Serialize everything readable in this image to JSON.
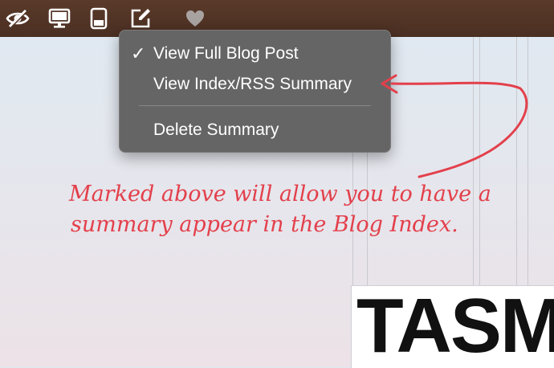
{
  "toolbar": {
    "icons": [
      "eye-slash-icon",
      "monitor-icon",
      "phone-icon",
      "edit-icon",
      "heart-icon"
    ]
  },
  "menu": {
    "items": [
      {
        "label": "View Full Blog Post",
        "checked": true,
        "check_glyph": "✓"
      },
      {
        "label": "View Index/RSS Summary",
        "checked": false
      },
      {
        "label": "Delete Summary",
        "checked": false
      }
    ]
  },
  "annotation": {
    "line1": "Marked above will allow you to have a",
    "line2": "summary appear in the Blog Index.",
    "color": "#e3404b"
  },
  "page": {
    "hero_text": "TASMA"
  },
  "colors": {
    "toolbar": "#4f3325",
    "menu_bg": "#666566",
    "annotation": "#e3404b"
  }
}
